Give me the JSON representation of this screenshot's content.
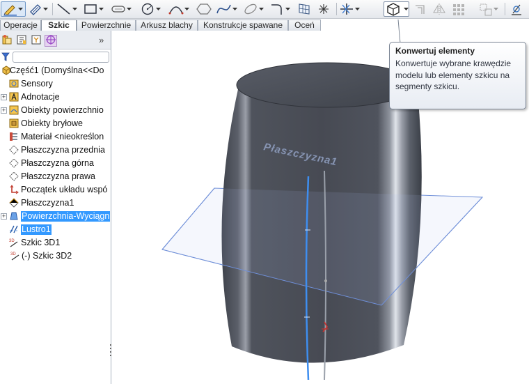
{
  "tabs": [
    "Operacje",
    "Szkic",
    "Powierzchnie",
    "Arkusz blachy",
    "Konstrukcje spawane",
    "Oceń"
  ],
  "selected_tab": "Szkic",
  "tree": {
    "root": "Część1  (Domyślna<<Do",
    "items": [
      "Sensory",
      "Adnotacje",
      "Obiekty powierzchnio",
      "Obiekty bryłowe",
      "Materiał <nieokreślon",
      "Płaszczyzna przednia",
      "Płaszczyzna górna",
      "Płaszczyzna prawa",
      "Początek układu wspó",
      "Płaszczyzna1",
      "Powierzchnia-Wyciągn",
      "Lustro1",
      "Szkic 3D1",
      "(-) Szkic 3D2"
    ]
  },
  "panel": {
    "expand_symbol": "»"
  },
  "viewport": {
    "plane_label": "Płaszczyzna1"
  },
  "tooltip": {
    "title": "Konwertuj elementy",
    "body": "Konwertuje wybrane krawędzie modelu lub elementy szkicu na segmenty szkicu."
  },
  "colors": {
    "accent": "#3399ff",
    "body_dark": "#4b4f59",
    "plane_edge": "#6f8fd8"
  }
}
